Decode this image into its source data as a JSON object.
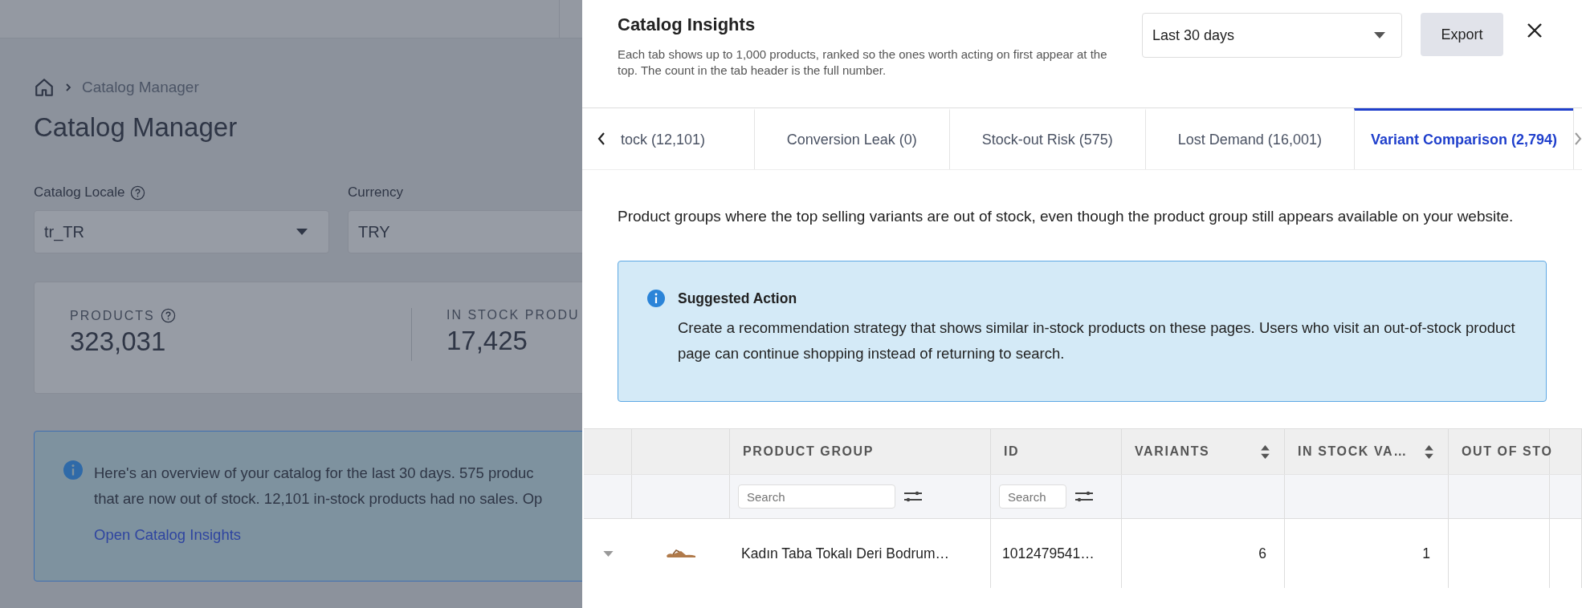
{
  "background_page": {
    "breadcrumb": [
      "Catalog Manager"
    ],
    "title": "Catalog Manager",
    "fields": [
      {
        "label": "Catalog Locale",
        "help": true,
        "value": "tr_TR",
        "dropdown": true
      },
      {
        "label": "Currency",
        "help": false,
        "value": "TRY"
      }
    ],
    "stats": [
      {
        "label": "PRODUCTS",
        "help": true,
        "value": "323,031"
      },
      {
        "label": "IN STOCK PRODU",
        "help": false,
        "value": "17,425"
      }
    ],
    "info": {
      "lines": [
        "Here's an overview of your catalog for the last 30 days. 575 produc",
        "that are now out of stock. 12,101 in-stock products had no sales. Op"
      ],
      "link": "Open Catalog Insights"
    }
  },
  "drawer": {
    "title": "Catalog Insights",
    "description": "Each tab shows up to 1,000 products, ranked so the ones worth acting on first appear at the top. The count in the tab header is the full number.",
    "date_range": {
      "value": "Last 30 days"
    },
    "export_button": "Export",
    "tabs": [
      {
        "label": "tock (12,101)",
        "selected": false
      },
      {
        "label": "Conversion Leak (0)",
        "selected": false
      },
      {
        "label": "Stock-out Risk (575)",
        "selected": false
      },
      {
        "label": "Lost Demand (16,001)",
        "selected": false
      },
      {
        "label": "Variant Comparison (2,794)",
        "selected": true
      }
    ],
    "tab_description": "Product groups where the top selling variants are out of stock, even though the product group still appears available on your website.",
    "suggested_action": {
      "title": "Suggested Action",
      "text": "Create a recommendation strategy that shows similar in-stock products on these pages. Users who visit an out-of-stock product page can continue shopping instead of returning to search."
    },
    "table": {
      "columns": [
        {
          "label": "PRODUCT GROUP",
          "sortable": false,
          "filter_placeholder": "Search"
        },
        {
          "label": "ID",
          "sortable": false,
          "filter_placeholder": "Search"
        },
        {
          "label": "VARIANTS",
          "sortable": true
        },
        {
          "label": "IN STOCK VA…",
          "sortable": true
        },
        {
          "label": "OUT OF STO"
        }
      ],
      "rows": [
        {
          "cells": [
            "Kadın Taba Tokalı Deri Bodrum…",
            "1012479541…",
            "6",
            "1"
          ]
        }
      ]
    }
  }
}
